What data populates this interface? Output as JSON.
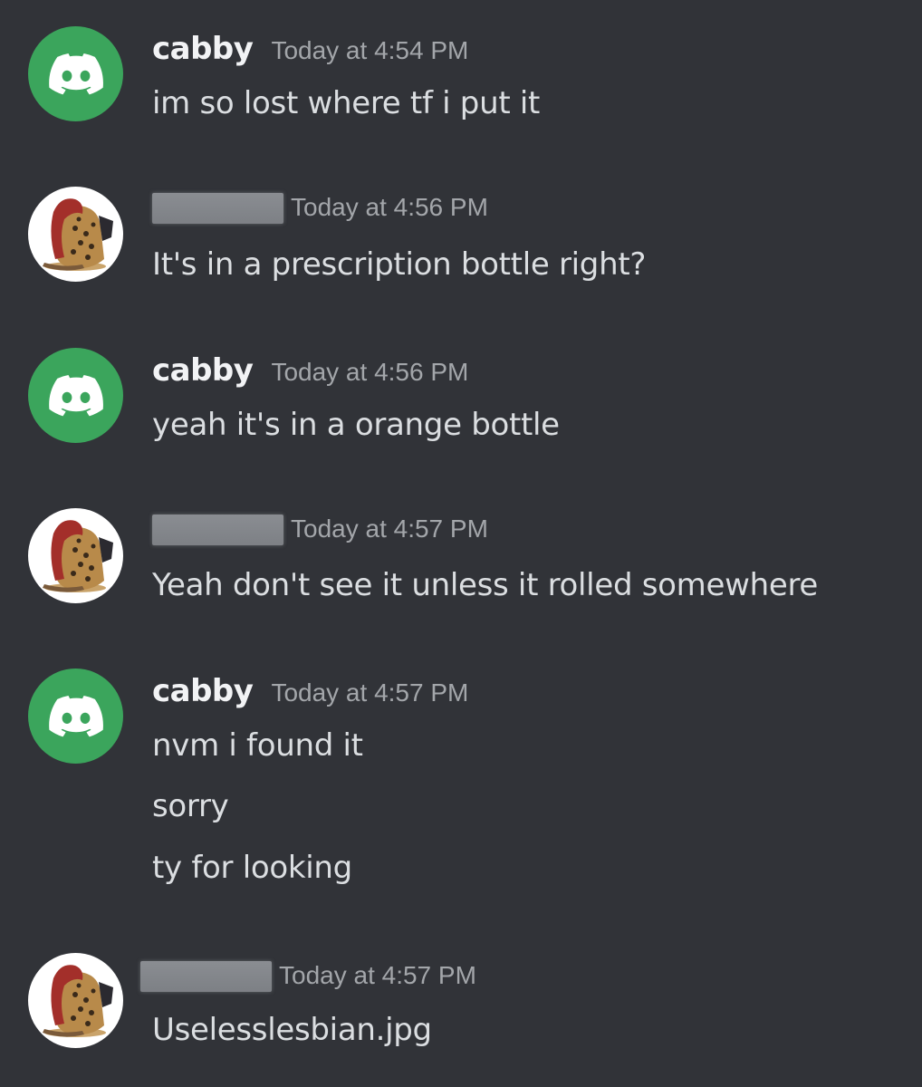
{
  "colors": {
    "background": "#313338",
    "discord_avatar": "#3ba55c",
    "username": "#f2f3f5",
    "timestamp": "#a3a6aa",
    "message_text": "#dbdee1",
    "redaction": "#84878c"
  },
  "messages": [
    {
      "author": "cabby",
      "avatar_icon": "discord-logo-icon",
      "timestamp": "Today at 4:54 PM",
      "lines": [
        "im so lost where tf i put it"
      ]
    },
    {
      "author": "",
      "author_redacted": true,
      "avatar_icon": "ocelot-avatar-icon",
      "timestamp": "Today at 4:56 PM",
      "lines": [
        "It's in a prescription bottle right?"
      ]
    },
    {
      "author": "cabby",
      "avatar_icon": "discord-logo-icon",
      "timestamp": "Today at 4:56 PM",
      "lines": [
        "yeah it's in a orange bottle"
      ]
    },
    {
      "author": "",
      "author_redacted": true,
      "avatar_icon": "ocelot-avatar-icon",
      "timestamp": "Today at 4:57 PM",
      "lines": [
        "Yeah don't see it unless it rolled somewhere"
      ]
    },
    {
      "author": "cabby",
      "avatar_icon": "discord-logo-icon",
      "timestamp": "Today at 4:57 PM",
      "lines": [
        "nvm i found it",
        "sorry",
        "ty for looking"
      ]
    },
    {
      "author": "",
      "author_redacted": true,
      "avatar_icon": "ocelot-avatar-icon",
      "timestamp": "Today at 4:57 PM",
      "lines": [
        "Uselesslesbian.jpg"
      ]
    }
  ]
}
